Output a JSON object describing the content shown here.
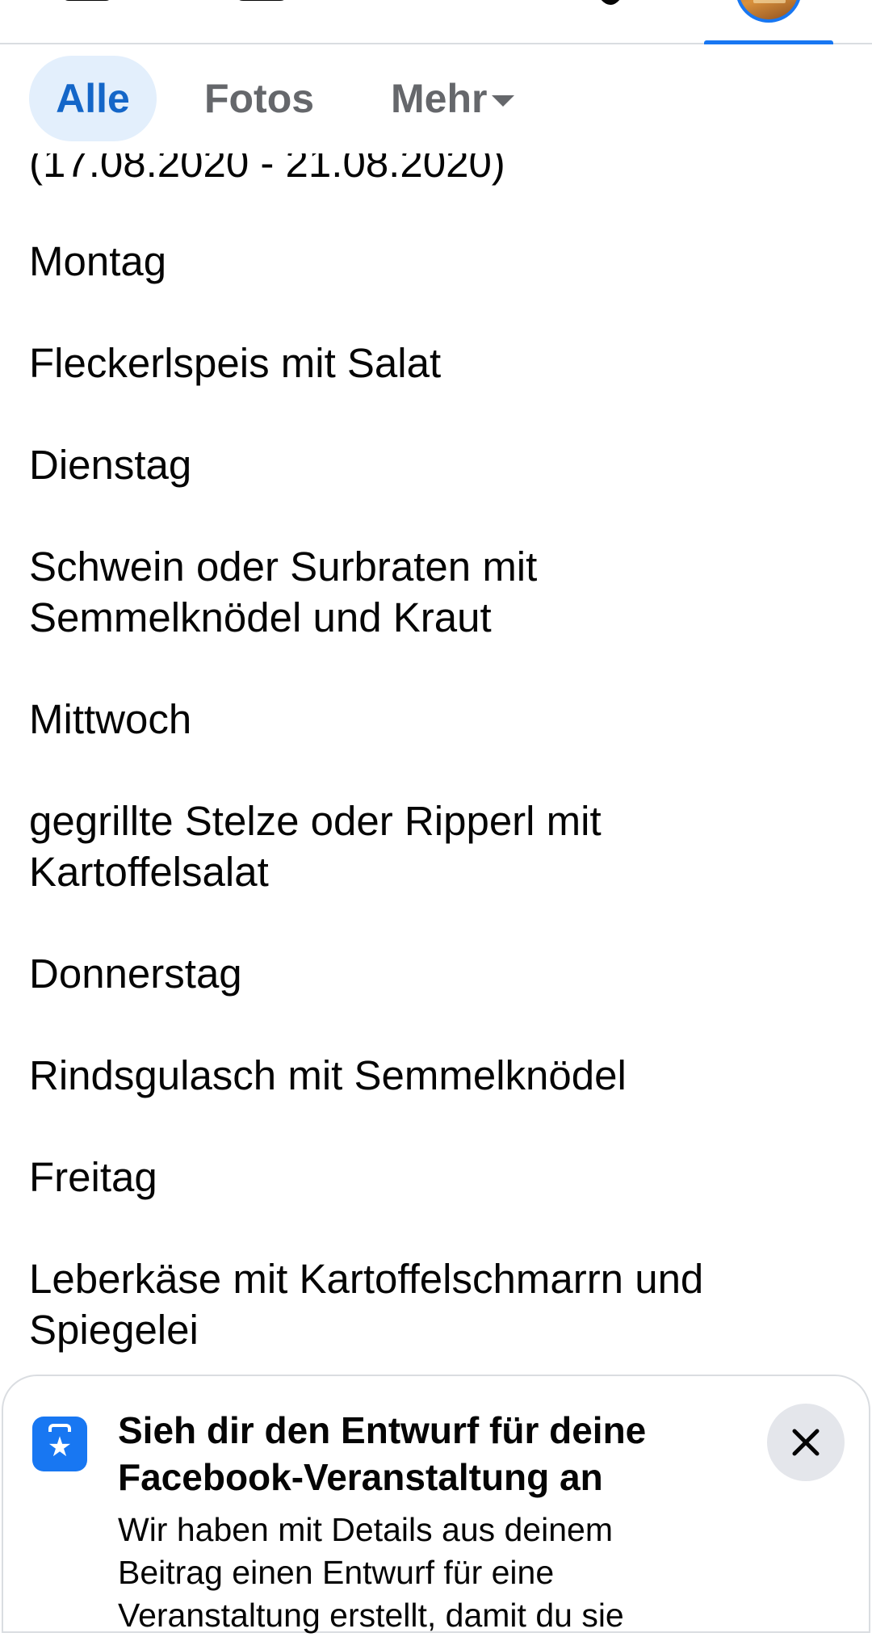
{
  "nav": {
    "tabs": [
      {
        "name": "home-icon",
        "active": false
      },
      {
        "name": "watch-icon",
        "active": false
      },
      {
        "name": "pages-megaphone-icon",
        "active": false
      },
      {
        "name": "notifications-bell-icon",
        "active": false
      },
      {
        "name": "profile-avatar",
        "active": true
      }
    ],
    "accent_color": "#1877f2"
  },
  "filters": {
    "all_label": "Alle",
    "photos_label": "Fotos",
    "more_label": "Mehr",
    "selected": "Alle"
  },
  "post": {
    "date_range": "(17.08.2020 - 21.08.2020)",
    "lines": [
      "Montag",
      "Fleckerlspeis mit Salat",
      "Dienstag",
      "Schwein oder Surbraten mit",
      "Semmelknödel und Kraut",
      "Mittwoch",
      "gegrillte Stelze oder Ripperl mit",
      "Kartoffelsalat",
      "Donnerstag",
      "Rindsgulasch mit Semmelknödel",
      "Freitag",
      "Leberkäse mit Kartoffelschmarrn und",
      "Spiegelei"
    ]
  },
  "sheet": {
    "title_line1": "Sieh dir den Entwurf für deine",
    "title_line2": "Facebook-Veranstaltung an",
    "body_line1": "Wir haben mit Details aus deinem",
    "body_line2": "Beitrag einen Entwurf für eine",
    "body_line3": "Veranstaltung erstellt, damit du sie"
  }
}
